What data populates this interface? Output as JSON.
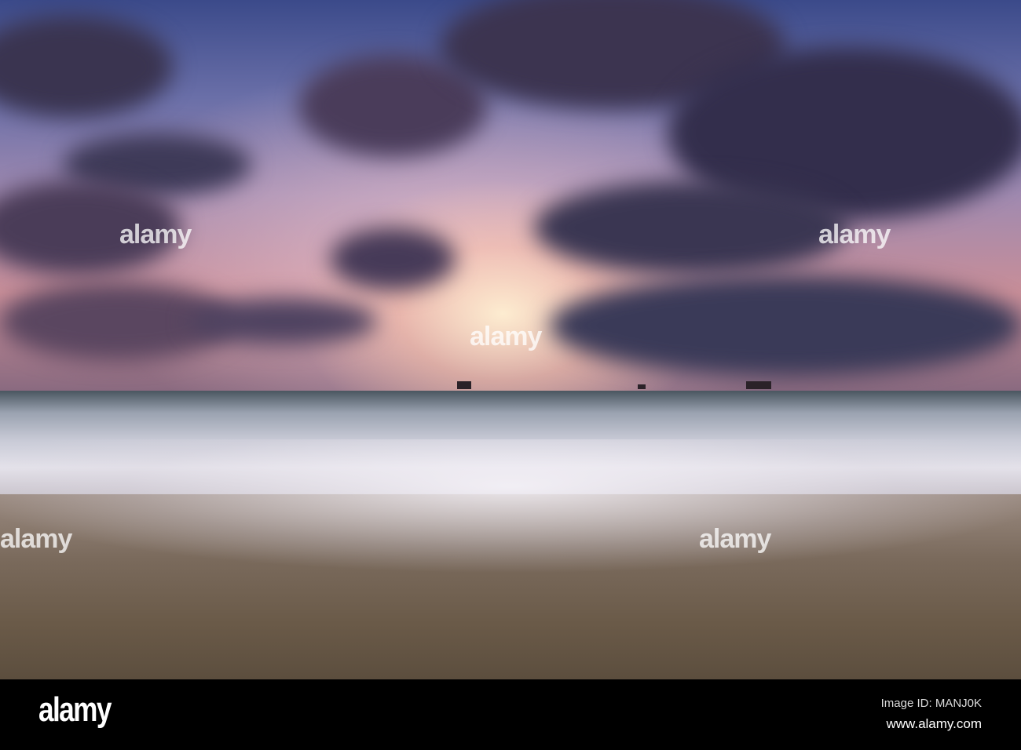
{
  "photo": {
    "subject": "sunset-over-sea-with-long-exposure-waves",
    "watermark": "alamy"
  },
  "footer": {
    "logo": "alamy",
    "image_id": "Image ID: MANJ0K",
    "url": "www.alamy.com"
  }
}
